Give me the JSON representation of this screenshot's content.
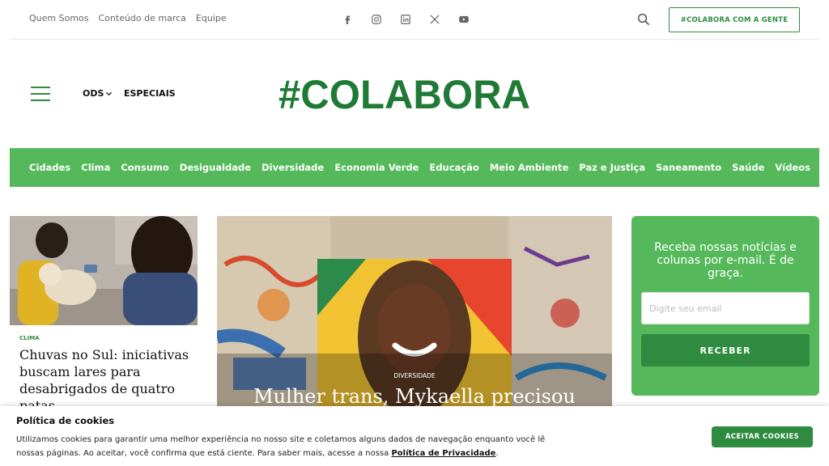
{
  "topbar": {
    "links": [
      "Quem Somos",
      "Conteúdo de marca",
      "Equipe"
    ],
    "social_icons": [
      "facebook-icon",
      "instagram-icon",
      "linkedin-icon",
      "x-icon",
      "youtube-icon"
    ],
    "cta_label": "#COLABORA COM A GENTE"
  },
  "header": {
    "nav_ods": "ODS",
    "nav_especiais": "ESPECIAIS",
    "logo_text": "#COLABORA"
  },
  "categories": [
    "Cidades",
    "Clima",
    "Consumo",
    "Desigualdade",
    "Diversidade",
    "Economia Verde",
    "Educação",
    "Meio Ambiente",
    "Paz e Justiça",
    "Saneamento",
    "Saúde",
    "Vídeos"
  ],
  "left_article": {
    "category": "CLIMA",
    "title": "Chuvas no Sul: iniciativas buscam lares para desabrigados de quatro patas"
  },
  "main_article": {
    "category": "DIVERSIDADE",
    "title": "Mulher trans, Mykaella precisou"
  },
  "newsletter": {
    "text": "Receba nossas notícias e colunas por e-mail. É de graça.",
    "placeholder": "Digite seu email",
    "button": "RECEBER"
  },
  "cookie": {
    "title": "Política de cookies",
    "text": "Utilizamos cookies para garantir uma melhor experiência no nosso site e coletamos alguns dados de navegação enquanto você lê nossas páginas. Ao aceitar, você confirma que está ciente. Para saber mais, acesse a nossa ",
    "link": "Política de Privacidade",
    "text_end": ".",
    "button": "ACEITAR COOKIES"
  },
  "colors": {
    "brand_green": "#2e8b3f",
    "category_bar": "#55b95b"
  }
}
